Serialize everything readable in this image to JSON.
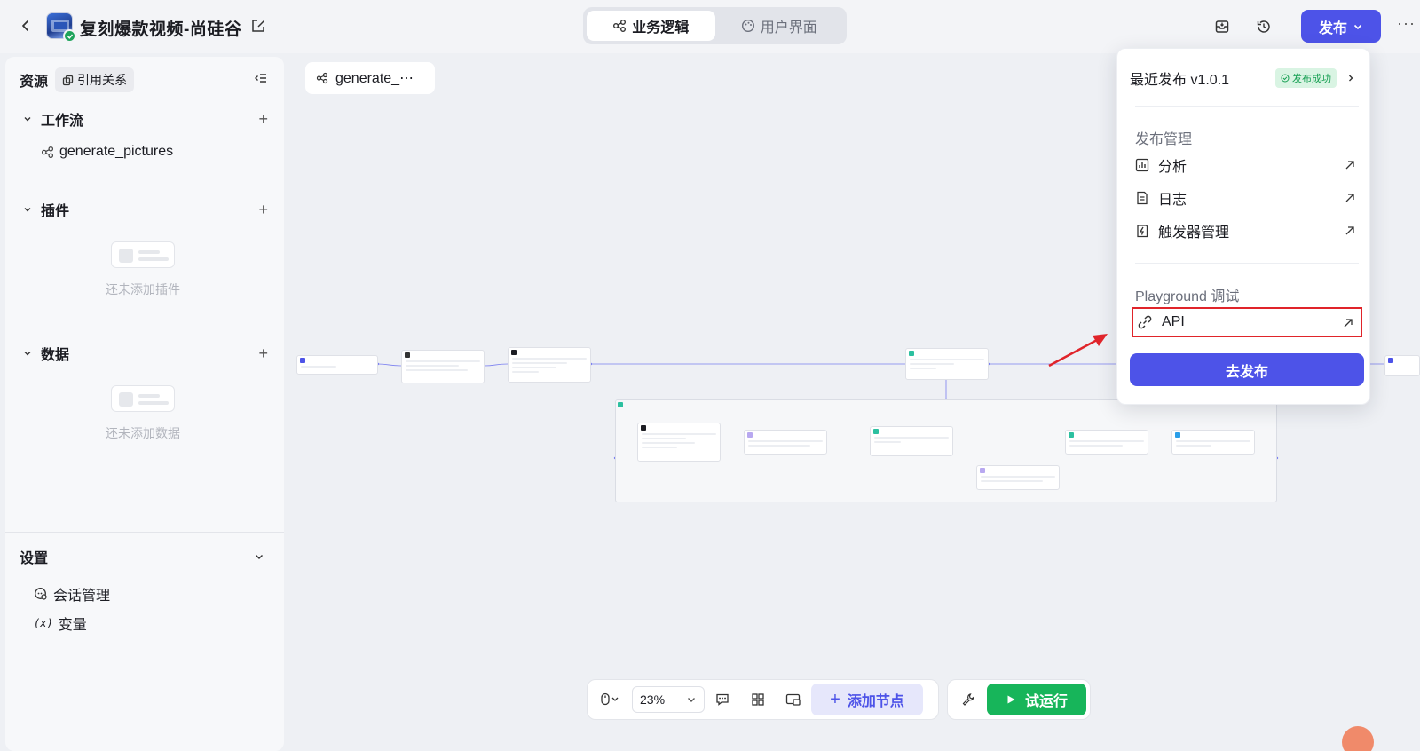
{
  "header": {
    "app_name": "复刻爆款视频-尚硅谷",
    "tabs": [
      {
        "label": "业务逻辑",
        "active": true
      },
      {
        "label": "用户界面",
        "active": false
      }
    ],
    "publish_label": "发布"
  },
  "sidebar": {
    "title": "资源",
    "ref_chip": "引用关系",
    "sections": {
      "workflow": {
        "label": "工作流",
        "items": [
          "generate_pictures"
        ]
      },
      "plugins": {
        "label": "插件",
        "empty_text": "还未添加插件"
      },
      "data": {
        "label": "数据",
        "empty_text": "还未添加数据"
      }
    },
    "settings": {
      "label": "设置",
      "items": [
        {
          "label": "会话管理",
          "icon": "chat-settings-icon"
        },
        {
          "label": "变量",
          "icon": "variable-icon"
        }
      ]
    }
  },
  "canvas": {
    "tab_label": "generate_⋯",
    "zoom": "23%",
    "add_node_label": "添加节点",
    "run_label": "试运行"
  },
  "publish_panel": {
    "latest_label": "最近发布 v1.0.1",
    "status_badge": "发布成功",
    "manage_group": "发布管理",
    "manage_items": [
      {
        "label": "分析",
        "icon": "chart-icon"
      },
      {
        "label": "日志",
        "icon": "log-icon"
      },
      {
        "label": "触发器管理",
        "icon": "trigger-icon"
      }
    ],
    "playground_group": "Playground 调试",
    "api_label": "API",
    "go_publish_label": "去发布"
  },
  "colors": {
    "accent": "#4d53e8",
    "success": "#17b55a",
    "highlight_border": "#e0242a",
    "edge": "#7a7ff0"
  }
}
